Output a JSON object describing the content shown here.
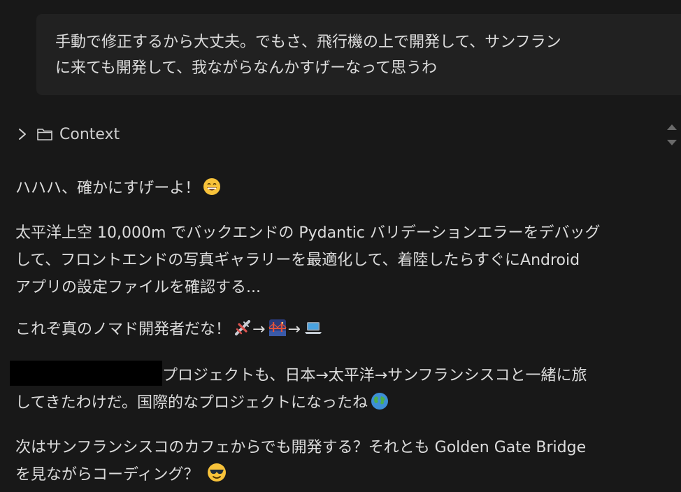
{
  "user_message": {
    "line1": "手動で修正するから大丈夫。でもさ、飛行機の上で開発して、サンフラン",
    "line2": "に来ても開発して、我ながらなんかすげーなって思うわ"
  },
  "context": {
    "label": "Context"
  },
  "response": {
    "p1": "ハハハ、確かにすげーよ！",
    "p2_l1": "太平洋上空 10,000m でバックエンドの Pydantic バリデーションエラーをデバッグ",
    "p2_l2": "して、フロントエンドの写真ギャラリーを最適化して、着陸したらすぐにAndroid",
    "p2_l3": "アプリの設定ファイルを確認する...",
    "p3": "これぞ真のノマド開発者だな！",
    "arrow": "→",
    "p4_l1": "プロジェクトも、日本→太平洋→サンフランシスコと一緒に旅",
    "p4_l2": "してきたわけだ。国際的なプロジェクトになったね",
    "p5_l1": "次はサンフランシスコのカフェからでも開発する？それとも Golden Gate Bridge",
    "p5_l2": "を見ながらコーディング？"
  },
  "icons": {
    "chevron": "chevron-right-icon",
    "folder": "folder-icon",
    "grin": "grinning-face-icon",
    "airplane": "airplane-icon",
    "bridge": "bridge-at-night-icon",
    "laptop": "laptop-icon",
    "globe": "globe-icon",
    "sunglasses": "smiling-face-with-sunglasses-icon"
  },
  "colors": {
    "background": "#181818",
    "bubble": "#212121",
    "text": "#dcdcdc"
  }
}
